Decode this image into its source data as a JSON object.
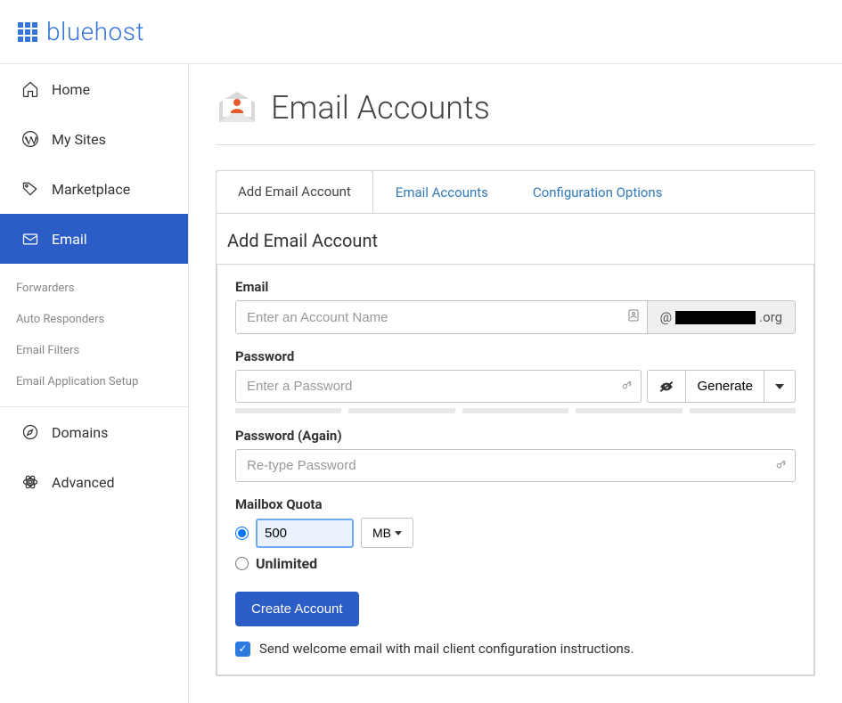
{
  "brand": "bluehost",
  "sidebar": {
    "items": [
      {
        "label": "Home",
        "icon": "home"
      },
      {
        "label": "My Sites",
        "icon": "wordpress"
      },
      {
        "label": "Marketplace",
        "icon": "tag"
      },
      {
        "label": "Email",
        "icon": "mail"
      },
      {
        "label": "Domains",
        "icon": "compass"
      },
      {
        "label": "Advanced",
        "icon": "atom"
      }
    ],
    "sub": [
      "Forwarders",
      "Auto Responders",
      "Email Filters",
      "Email Application Setup"
    ]
  },
  "page": {
    "title": "Email Accounts"
  },
  "tabs": [
    "Add Email Account",
    "Email Accounts",
    "Configuration Options"
  ],
  "form": {
    "heading": "Add Email Account",
    "email_label": "Email",
    "email_placeholder": "Enter an Account Name",
    "domain_prefix": "@",
    "domain_suffix": ".org",
    "password_label": "Password",
    "password_placeholder": "Enter a Password",
    "generate_label": "Generate",
    "password_again_label": "Password (Again)",
    "password_again_placeholder": "Re-type Password",
    "quota_label": "Mailbox Quota",
    "quota_value": "500",
    "quota_unit": "MB",
    "unlimited_label": "Unlimited",
    "submit_label": "Create Account",
    "welcome_label": "Send welcome email with mail client configuration instructions."
  }
}
